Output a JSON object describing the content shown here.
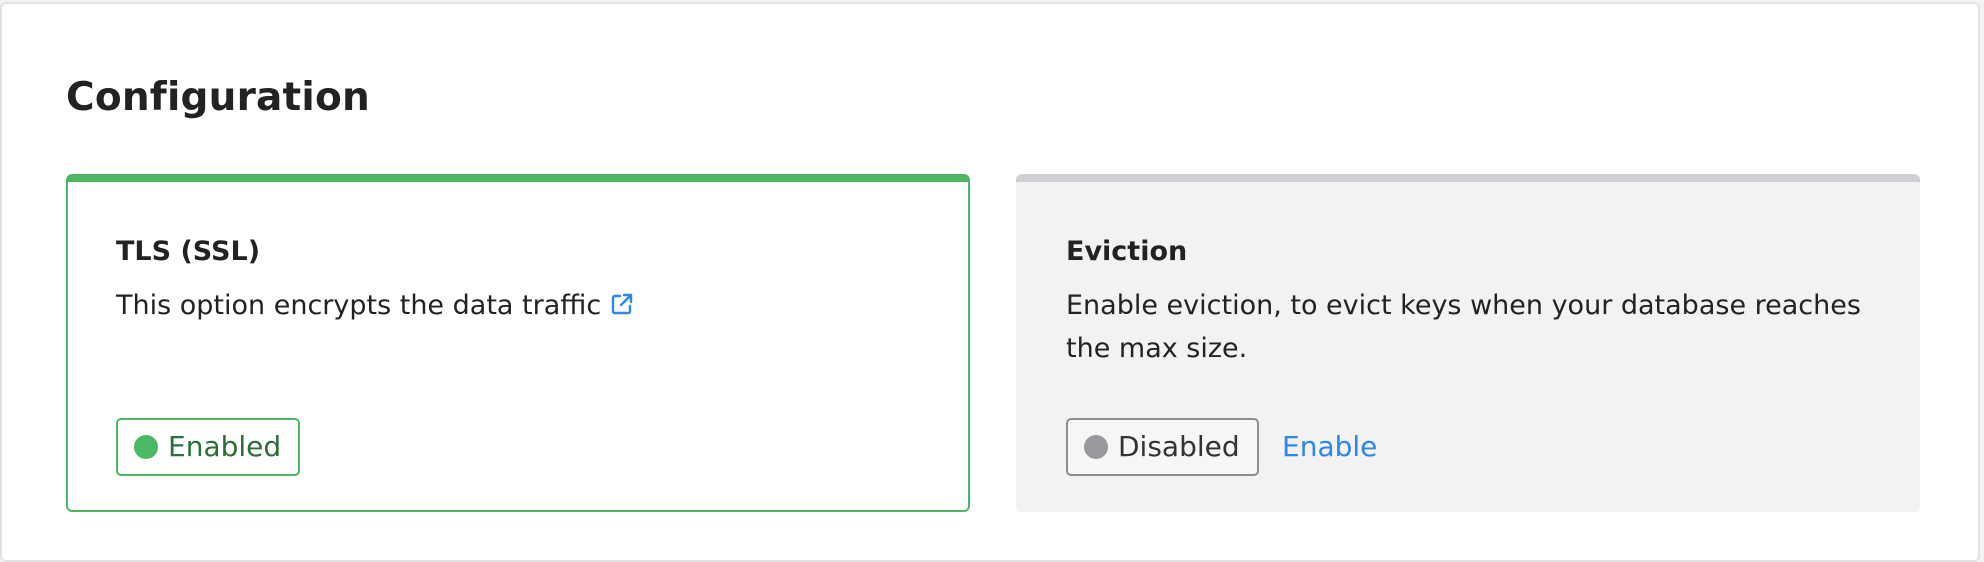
{
  "section": {
    "title": "Configuration"
  },
  "tls_card": {
    "title": "TLS (SSL)",
    "description": "This option encrypts the data traffic",
    "link_icon": "external-link-icon",
    "status_label": "Enabled",
    "status_color": "#4cb863"
  },
  "eviction_card": {
    "title": "Eviction",
    "description": "Enable eviction, to evict keys when your database reaches the max size.",
    "status_label": "Disabled",
    "status_color": "#98989e",
    "action_label": "Enable",
    "action_color": "#2e86e6"
  }
}
